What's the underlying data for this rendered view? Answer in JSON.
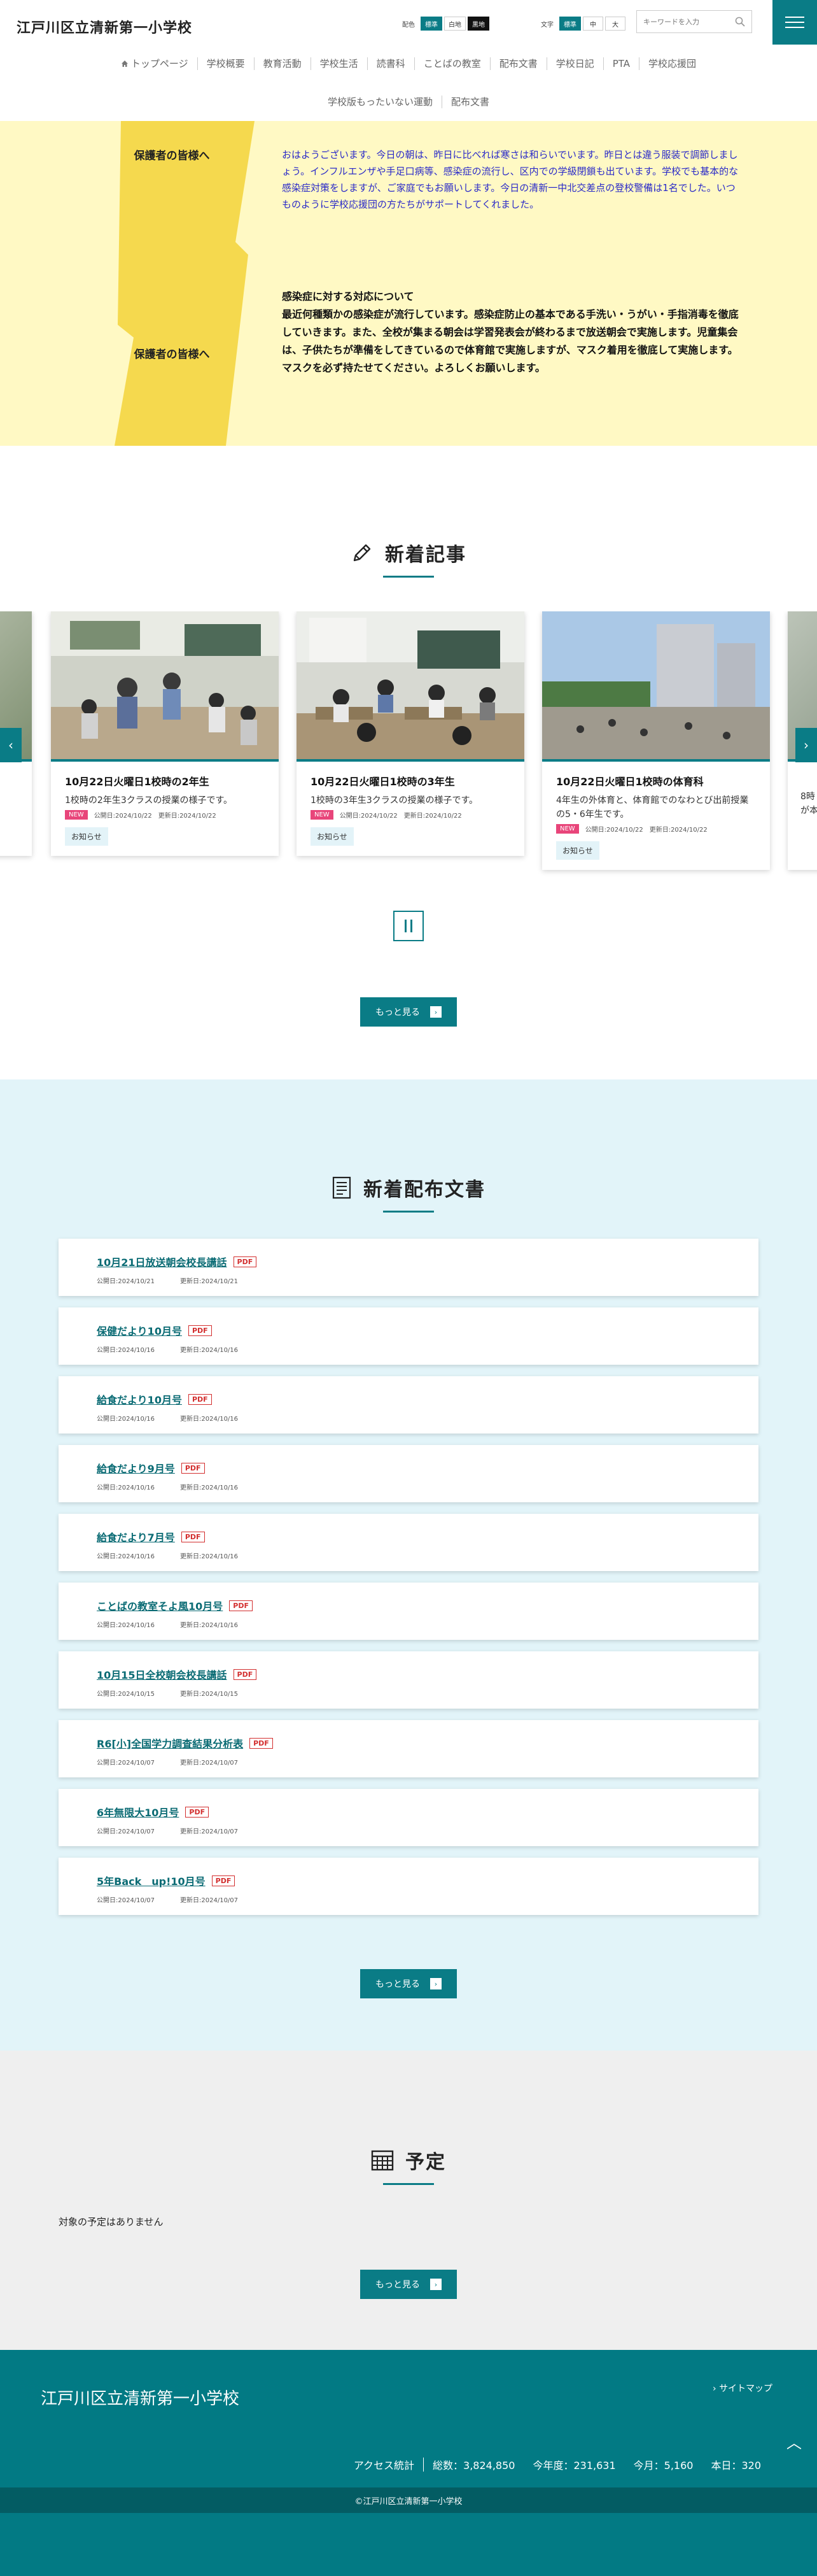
{
  "header": {
    "site_title": "江戸川区立清新第一小学校",
    "color_label": "配色",
    "color_options": [
      "標準",
      "白地",
      "黒地"
    ],
    "font_label": "文字",
    "font_options": [
      "標準",
      "中",
      "大"
    ],
    "search_placeholder": "キーワードを入力",
    "search_icon": "search-icon",
    "menu_icon": "hamburger-icon"
  },
  "nav": {
    "row1": [
      "トップページ",
      "学校概要",
      "教育活動",
      "学校生活",
      "読書科",
      "ことばの教室",
      "配布文書",
      "学校日記",
      "PTA",
      "学校応援団"
    ],
    "row2": [
      "学校版もったいない運動",
      "配布文書"
    ]
  },
  "notice": {
    "label1": "保護者の皆様へ",
    "text1": "おはようございます。今日の朝は、昨日に比べれば寒さは和らいでいます。昨日とは違う服装で調節しましょう。インフルエンザや手足口病等、感染症の流行し、区内での学級閉鎖も出ています。学校でも基本的な感染症対策をしますが、ご家庭でもお願いします。今日の清新一中北交差点の登校警備は1名でした。いつものように学校応援団の方たちがサポートしてくれました。",
    "label2": "保護者の皆様へ",
    "text2_title": "感染症に対する対応について",
    "text2": "最近何種類かの感染症が流行しています。感染症防止の基本である手洗い・うがい・手指消毒を徹底していきます。また、全校が集まる朝会は学習発表会が終わるまで放送朝会で実施します。児童集会は、子供たちが準備をしてきているので体育館で実施しますが、マスク着用を徹底して実施します。マスクを必ず持たせてください。よろしくお願いします。"
  },
  "news": {
    "title": "新着記事",
    "icon": "pencil-icon",
    "cards": [
      {
        "title": "10月22日火曜日1校時の2年生",
        "desc": "1校時の2年生3クラスの授業の様子です。",
        "new": "NEW",
        "published": "公開日:2024/10/22",
        "updated": "更新日:2024/10/22",
        "category": "お知らせ"
      },
      {
        "title": "10月22日火曜日1校時の3年生",
        "desc": "1校時の3年生3クラスの授業の様子です。",
        "new": "NEW",
        "published": "公開日:2024/10/22",
        "updated": "更新日:2024/10/22",
        "category": "お知らせ"
      },
      {
        "title": "10月22日火曜日1校時の体育科",
        "desc": "4年生の外体育と、体育館でのなわとび出前授業の5・6年生です。",
        "new": "NEW",
        "published": "公開日:2024/10/22",
        "updated": "更新日:2024/10/22",
        "category": "お知らせ"
      }
    ],
    "partial_right": {
      "line1": "8時",
      "line2": "が本"
    },
    "prev_icon": "chevron-left-icon",
    "next_icon": "chevron-right-icon",
    "pause_icon": "pause-icon",
    "more_label": "もっと見る"
  },
  "docs": {
    "title": "新着配布文書",
    "icon": "document-list-icon",
    "pdf_label": "PDF",
    "items": [
      {
        "title": "10月21日放送朝会校長講話",
        "published": "公開日:2024/10/21",
        "updated": "更新日:2024/10/21"
      },
      {
        "title": "保健だより10月号",
        "published": "公開日:2024/10/16",
        "updated": "更新日:2024/10/16"
      },
      {
        "title": "給食だより10月号",
        "published": "公開日:2024/10/16",
        "updated": "更新日:2024/10/16"
      },
      {
        "title": "給食だより9月号",
        "published": "公開日:2024/10/16",
        "updated": "更新日:2024/10/16"
      },
      {
        "title": "給食だより7月号",
        "published": "公開日:2024/10/16",
        "updated": "更新日:2024/10/16"
      },
      {
        "title": "ことばの教室そよ風10月号",
        "published": "公開日:2024/10/16",
        "updated": "更新日:2024/10/16"
      },
      {
        "title": "10月15日全校朝会校長講話",
        "published": "公開日:2024/10/15",
        "updated": "更新日:2024/10/15"
      },
      {
        "title": "R6[小]全国学力調査結果分析表",
        "published": "公開日:2024/10/07",
        "updated": "更新日:2024/10/07"
      },
      {
        "title": "6年無限大10月号",
        "published": "公開日:2024/10/07",
        "updated": "更新日:2024/10/07"
      },
      {
        "title": "5年Back　up!10月号",
        "published": "公開日:2024/10/07",
        "updated": "更新日:2024/10/07"
      }
    ],
    "more_label": "もっと見る"
  },
  "schedule": {
    "title": "予定",
    "icon": "calendar-icon",
    "empty_text": "対象の予定はありません",
    "more_label": "もっと見る"
  },
  "footer": {
    "title": "江戸川区立清新第一小学校",
    "sitemap": "サイトマップ",
    "top_icon": "chevron-up-icon",
    "stats_label": "アクセス統計",
    "total": "総数：3,824,850",
    "year": "今年度：231,631",
    "month": "今月：5,160",
    "today": "本日：320",
    "copyright": "©江戸川区立清新第一小学校"
  },
  "colors": {
    "accent": "#0a7c86",
    "notice_bg": "#fff9c4",
    "bolt": "#f5d94e",
    "docs_bg": "#e2f4f9",
    "new_badge": "#e8457a",
    "pdf": "#d32f2f"
  }
}
